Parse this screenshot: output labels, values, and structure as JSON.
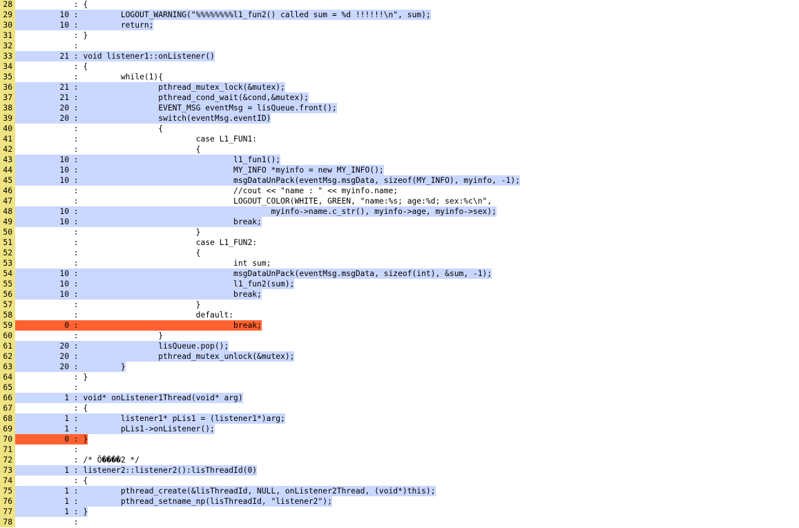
{
  "colors": {
    "line_number_bg": "#efe383",
    "hit_bg": "#cad7fe",
    "miss_bg": "#ff6230"
  },
  "lines": [
    {
      "n": "28",
      "count": "",
      "code": "{",
      "status": "none"
    },
    {
      "n": "29",
      "count": "10",
      "code": "        LOGOUT_WARNING(\"%%%%%%%%l1_fun2() called sum = %d !!!!!!\\n\", sum);",
      "status": "hit"
    },
    {
      "n": "30",
      "count": "10",
      "code": "        return;",
      "status": "hit"
    },
    {
      "n": "31",
      "count": "",
      "code": "}",
      "status": "none"
    },
    {
      "n": "32",
      "count": "",
      "code": "",
      "status": "none"
    },
    {
      "n": "33",
      "count": "21",
      "code": "void listener1::onListener()",
      "status": "hit"
    },
    {
      "n": "34",
      "count": "",
      "code": "{",
      "status": "none"
    },
    {
      "n": "35",
      "count": "",
      "code": "        while(1){",
      "status": "none"
    },
    {
      "n": "36",
      "count": "21",
      "code": "                pthread_mutex_lock(&mutex);",
      "status": "hit"
    },
    {
      "n": "37",
      "count": "21",
      "code": "                pthread_cond_wait(&cond,&mutex);",
      "status": "hit"
    },
    {
      "n": "38",
      "count": "20",
      "code": "                EVENT_MSG eventMsg = lisQueue.front();",
      "status": "hit"
    },
    {
      "n": "39",
      "count": "20",
      "code": "                switch(eventMsg.eventID)",
      "status": "hit"
    },
    {
      "n": "40",
      "count": "",
      "code": "                {",
      "status": "none"
    },
    {
      "n": "41",
      "count": "",
      "code": "                        case L1_FUN1:",
      "status": "none"
    },
    {
      "n": "42",
      "count": "",
      "code": "                        {",
      "status": "none"
    },
    {
      "n": "43",
      "count": "10",
      "code": "                                l1_fun1();",
      "status": "hit"
    },
    {
      "n": "44",
      "count": "10",
      "code": "                                MY_INFO *myinfo = new MY_INFO();",
      "status": "hit"
    },
    {
      "n": "45",
      "count": "10",
      "code": "                                msgDataUnPack(eventMsg.msgData, sizeof(MY_INFO), myinfo, -1);",
      "status": "hit"
    },
    {
      "n": "46",
      "count": "",
      "code": "                                //cout << \"name : \" << myinfo.name;",
      "status": "none"
    },
    {
      "n": "47",
      "count": "",
      "code": "                                LOGOUT_COLOR(WHITE, GREEN, \"name:%s; age:%d; sex:%c\\n\",",
      "status": "none"
    },
    {
      "n": "48",
      "count": "10",
      "code": "                                        myinfo->name.c_str(), myinfo->age, myinfo->sex);",
      "status": "hit"
    },
    {
      "n": "49",
      "count": "10",
      "code": "                                break;",
      "status": "hit"
    },
    {
      "n": "50",
      "count": "",
      "code": "                        }",
      "status": "none"
    },
    {
      "n": "51",
      "count": "",
      "code": "                        case L1_FUN2:",
      "status": "none"
    },
    {
      "n": "52",
      "count": "",
      "code": "                        {",
      "status": "none"
    },
    {
      "n": "53",
      "count": "",
      "code": "                                int sum;",
      "status": "none"
    },
    {
      "n": "54",
      "count": "10",
      "code": "                                msgDataUnPack(eventMsg.msgData, sizeof(int), &sum, -1);",
      "status": "hit"
    },
    {
      "n": "55",
      "count": "10",
      "code": "                                l1_fun2(sum);",
      "status": "hit"
    },
    {
      "n": "56",
      "count": "10",
      "code": "                                break;",
      "status": "hit"
    },
    {
      "n": "57",
      "count": "",
      "code": "                        }",
      "status": "none"
    },
    {
      "n": "58",
      "count": "",
      "code": "                        default:",
      "status": "none"
    },
    {
      "n": "59",
      "count": "0",
      "code": "                                break;",
      "status": "miss"
    },
    {
      "n": "60",
      "count": "",
      "code": "                }",
      "status": "none"
    },
    {
      "n": "61",
      "count": "20",
      "code": "                lisQueue.pop();",
      "status": "hit"
    },
    {
      "n": "62",
      "count": "20",
      "code": "                pthread_mutex_unlock(&mutex);",
      "status": "hit"
    },
    {
      "n": "63",
      "count": "20",
      "code": "        }",
      "status": "hit"
    },
    {
      "n": "64",
      "count": "",
      "code": "}",
      "status": "none"
    },
    {
      "n": "65",
      "count": "",
      "code": "",
      "status": "none"
    },
    {
      "n": "66",
      "count": "1",
      "code": "void* onListener1Thread(void* arg)",
      "status": "hit"
    },
    {
      "n": "67",
      "count": "",
      "code": "{",
      "status": "none"
    },
    {
      "n": "68",
      "count": "1",
      "code": "        listener1* pLis1 = (listener1*)arg;",
      "status": "hit"
    },
    {
      "n": "69",
      "count": "1",
      "code": "        pLis1->onListener();",
      "status": "hit"
    },
    {
      "n": "70",
      "count": "0",
      "code": "}",
      "status": "miss"
    },
    {
      "n": "71",
      "count": "",
      "code": "",
      "status": "none"
    },
    {
      "n": "72",
      "count": "",
      "code": "/* Ö����2 */",
      "status": "none"
    },
    {
      "n": "73",
      "count": "1",
      "code": "listener2::listener2():lisThreadId(0)",
      "status": "hit"
    },
    {
      "n": "74",
      "count": "",
      "code": "{",
      "status": "none"
    },
    {
      "n": "75",
      "count": "1",
      "code": "        pthread_create(&lisThreadId, NULL, onListener2Thread, (void*)this);",
      "status": "hit"
    },
    {
      "n": "76",
      "count": "1",
      "code": "        pthread_setname_np(lisThreadId, \"listener2\");",
      "status": "hit"
    },
    {
      "n": "77",
      "count": "1",
      "code": "}",
      "status": "hit"
    },
    {
      "n": "78",
      "count": "",
      "code": "",
      "status": "none"
    }
  ]
}
